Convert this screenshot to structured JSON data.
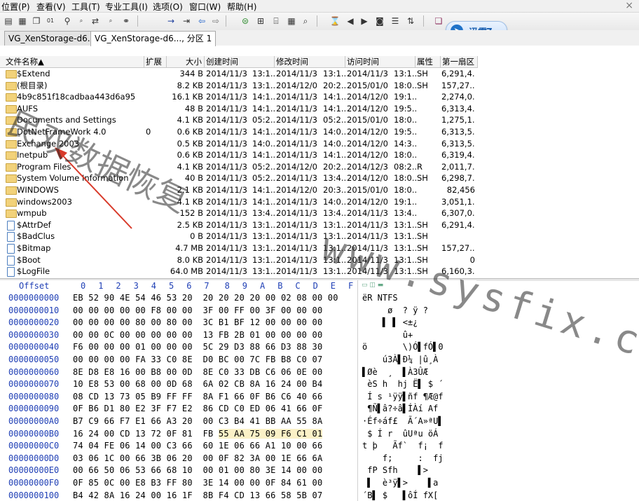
{
  "menu": [
    "位置(P)",
    "查看(V)",
    "工具(T)",
    "专业工具(I)",
    "选项(O)",
    "窗口(W)",
    "帮助(H)"
  ],
  "close_glyph": "×",
  "thunder_badge": "迅雷7",
  "tabs": [
    "VG_XenStorage-d6...",
    "VG_XenStorage-d6..., 分区 1"
  ],
  "columns": [
    "文件名称▲",
    "扩展",
    "大小",
    "创建时间",
    "修改时间",
    "访问时间",
    "属性",
    "第一扇区"
  ],
  "files": [
    {
      "name": "$Extend",
      "ext": "",
      "size": "344 B",
      "created": "2014/11/30",
      "ct": "13:1...",
      "modified": "2014/11/30",
      "mt": "13:1...",
      "accessed": "2014/11/30",
      "at": "13:1...",
      "attr": "SH",
      "sector": "6,291,4...",
      "icon": "folder"
    },
    {
      "name": "(根目录)",
      "ext": "",
      "size": "8.2 KB",
      "created": "2014/11/30",
      "ct": "13:1...",
      "modified": "2014/12/01",
      "mt": "20:2...",
      "accessed": "2015/01/03",
      "at": "18:0...",
      "attr": "SH",
      "sector": "157,27...",
      "icon": "folder"
    },
    {
      "name": "4b9c851f18cadbaa443d6a95",
      "ext": "",
      "size": "16.1 KB",
      "created": "2014/11/30",
      "ct": "14:1...",
      "modified": "2014/11/30",
      "mt": "14:1...",
      "accessed": "2014/12/01",
      "at": "19:1...",
      "attr": "",
      "sector": "2,274,0...",
      "icon": "folder"
    },
    {
      "name": "AUFS",
      "ext": "",
      "size": "48 B",
      "created": "2014/11/30",
      "ct": "14:1...",
      "modified": "2014/11/30",
      "mt": "14:1...",
      "accessed": "2014/12/01",
      "at": "19:5...",
      "attr": "",
      "sector": "6,313,4...",
      "icon": "folder"
    },
    {
      "name": "Documents and Settings",
      "ext": "",
      "size": "4.1 KB",
      "created": "2014/11/30",
      "ct": "05:2...",
      "modified": "2014/11/30",
      "mt": "05:2...",
      "accessed": "2015/01/03",
      "at": "18:0...",
      "attr": "",
      "sector": "1,275,1...",
      "icon": "folder"
    },
    {
      "name": "DotNetFrameWork 4.0",
      "ext": "0",
      "size": "0.6 KB",
      "created": "2014/11/30",
      "ct": "14:1...",
      "modified": "2014/11/30",
      "mt": "14:0...",
      "accessed": "2014/12/01",
      "at": "19:5...",
      "attr": "",
      "sector": "6,313,5...",
      "icon": "folder"
    },
    {
      "name": "Exchange 2003",
      "ext": "",
      "size": "0.5 KB",
      "created": "2014/11/30",
      "ct": "14:0...",
      "modified": "2014/11/30",
      "mt": "14:0...",
      "accessed": "2014/12/02",
      "at": "14:3...",
      "attr": "",
      "sector": "6,313,5...",
      "icon": "folder"
    },
    {
      "name": "Inetpub",
      "ext": "",
      "size": "0.6 KB",
      "created": "2014/11/30",
      "ct": "14:1...",
      "modified": "2014/11/30",
      "mt": "14:1...",
      "accessed": "2014/12/04",
      "at": "18:0...",
      "attr": "",
      "sector": "6,319,4...",
      "icon": "folder"
    },
    {
      "name": "Program Files",
      "ext": "",
      "size": "4.1 KB",
      "created": "2014/11/30",
      "ct": "05:2...",
      "modified": "2014/12/01",
      "mt": "20:2...",
      "accessed": "2014/12/31",
      "at": "08:2...",
      "attr": "R",
      "sector": "2,011,7...",
      "icon": "folder"
    },
    {
      "name": "System Volume Information",
      "ext": "",
      "size": "40 B",
      "created": "2014/11/30",
      "ct": "05:2...",
      "modified": "2014/11/30",
      "mt": "13:4...",
      "accessed": "2014/12/04",
      "at": "18:0...",
      "attr": "SH",
      "sector": "6,298,7...",
      "icon": "folder"
    },
    {
      "name": "WINDOWS",
      "ext": "",
      "size": "2.1 KB",
      "created": "2014/11/30",
      "ct": "14:1...",
      "modified": "2014/12/01",
      "mt": "20:3...",
      "accessed": "2015/01/03",
      "at": "18:0...",
      "attr": "",
      "sector": "82,456",
      "icon": "folder"
    },
    {
      "name": "windows2003",
      "ext": "",
      "size": "4.1 KB",
      "created": "2014/11/30",
      "ct": "14:1...",
      "modified": "2014/11/30",
      "mt": "14:0...",
      "accessed": "2014/12/01",
      "at": "19:1...",
      "attr": "",
      "sector": "3,051,1...",
      "icon": "folder"
    },
    {
      "name": "wmpub",
      "ext": "",
      "size": "152 B",
      "created": "2014/11/30",
      "ct": "13:4...",
      "modified": "2014/11/30",
      "mt": "13:4...",
      "accessed": "2014/11/30",
      "at": "13:4...",
      "attr": "",
      "sector": "6,307,0...",
      "icon": "folder"
    },
    {
      "name": "$AttrDef",
      "ext": "",
      "size": "2.5 KB",
      "created": "2014/11/30",
      "ct": "13:1...",
      "modified": "2014/11/30",
      "mt": "13:1...",
      "accessed": "2014/11/30",
      "at": "13:1...",
      "attr": "SH",
      "sector": "6,291,4...",
      "icon": "file"
    },
    {
      "name": "$BadClus",
      "ext": "",
      "size": "0 B",
      "created": "2014/11/30",
      "ct": "13:1...",
      "modified": "2014/11/30",
      "mt": "13:1...",
      "accessed": "2014/11/30",
      "at": "13:1...",
      "attr": "SH",
      "sector": "",
      "icon": "file"
    },
    {
      "name": "$Bitmap",
      "ext": "",
      "size": "4.7 MB",
      "created": "2014/11/30",
      "ct": "13:1...",
      "modified": "2014/11/30",
      "mt": "13:1...",
      "accessed": "2014/11/30",
      "at": "13:1...",
      "attr": "SH",
      "sector": "157,27...",
      "icon": "file"
    },
    {
      "name": "$Boot",
      "ext": "",
      "size": "8.0 KB",
      "created": "2014/11/30",
      "ct": "13:1...",
      "modified": "2014/11/30",
      "mt": "13:1...",
      "accessed": "2014/11/30",
      "at": "13:1...",
      "attr": "SH",
      "sector": "0",
      "icon": "file"
    },
    {
      "name": "$LogFile",
      "ext": "",
      "size": "64.0 MB",
      "created": "2014/11/30",
      "ct": "13:1...",
      "modified": "2014/11/30",
      "mt": "13:1...",
      "accessed": "2014/11/30",
      "at": "13:1...",
      "attr": "SH",
      "sector": "6,160,3...",
      "icon": "file"
    }
  ],
  "hex": {
    "offset_label": "Offset",
    "columns": [
      "0",
      "1",
      "2",
      "3",
      "4",
      "5",
      "6",
      "7",
      "8",
      "9",
      "A",
      "B",
      "C",
      "D",
      "E",
      "F"
    ],
    "rows": [
      {
        "off": "0000000000",
        "bytes": "EB 52 90 4E 54 46 53 20  20 20 20 20 00 02 08 00 00",
        "ascii": "ëR NTFS"
      },
      {
        "off": "0000000010",
        "bytes": "00 00 00 00 00 F8 00 00  3F 00 FF 00 3F 00 00 00",
        "ascii": "     ø  ? ÿ ?"
      },
      {
        "off": "0000000020",
        "bytes": "00 00 00 00 80 00 80 00  3C B1 BF 12 00 00 00 00",
        "ascii": "    ▌ ▌ <±¿"
      },
      {
        "off": "0000000030",
        "bytes": "00 00 0C 00 00 00 00 00  13 FB 2B 01 00 00 00 00",
        "ascii": "        û+"
      },
      {
        "off": "0000000040",
        "bytes": "F6 00 00 00 01 00 00 00  5C 29 D3 88 66 D3 88 30",
        "ascii": "ö       \\)Ó▌fÓ▌0"
      },
      {
        "off": "0000000050",
        "bytes": "00 00 00 00 FA 33 C0 8E  D0 BC 00 7C FB B8 C0 07",
        "ascii": "    ú3À▌Ð¼ |û¸À"
      },
      {
        "off": "0000000060",
        "bytes": "8E D8 E8 16 00 B8 00 0D  8E C0 33 DB C6 06 0E 00",
        "ascii": "▌Øè  ¸  ▌À3ÛÆ"
      },
      {
        "off": "0000000070",
        "bytes": "10 E8 53 00 68 00 0D 68  6A 02 CB 8A 16 24 00 B4",
        "ascii": " èS h  hj Ë▌ $ ´"
      },
      {
        "off": "0000000080",
        "bytes": "08 CD 13 73 05 B9 FF FF  8A F1 66 0F B6 C6 40 66",
        "ascii": " Í s ¹ÿÿ▌ñf ¶Æ@f"
      },
      {
        "off": "0000000090",
        "bytes": "0F B6 D1 80 E2 3F F7 E2  86 CD C0 ED 06 41 66 0F",
        "ascii": " ¶Ñ▌â?÷â▌ÍÀí Af"
      },
      {
        "off": "00000000A0",
        "bytes": "B7 C9 66 F7 E1 66 A3 20  00 C3 B4 41 BB AA 55 8A",
        "ascii": "·Éf÷áf£  Ã´A»ªU▌"
      },
      {
        "off": "00000000B0",
        "bytes": "16 24 00 CD 13 72 0F 81  FB 55 AA 75 09 F6 C1 01",
        "ascii": " $ Í r  ûUªu öÁ"
      },
      {
        "off": "00000000C0",
        "bytes": "74 04 FE 06 14 00 C3 66  60 1E 06 66 A1 10 00 66",
        "ascii": "t þ   Ãf`  f¡  f"
      },
      {
        "off": "00000000D0",
        "bytes": "03 06 1C 00 66 3B 06 20  00 0F 82 3A 00 1E 66 6A",
        "ascii": "    f;     :  fj"
      },
      {
        "off": "00000000E0",
        "bytes": "00 66 50 06 53 66 68 10  00 01 00 80 3E 14 00 00",
        "ascii": " fP Sfh    ▌>"
      },
      {
        "off": "00000000F0",
        "bytes": "0F 85 0C 00 E8 B3 FF 80  3E 14 00 00 0F 84 61 00",
        "ascii": " ▌  è³ÿ▌>    ▌a"
      },
      {
        "off": "0000000100",
        "bytes": "B4 42 8A 16 24 00 16 1F  8B F4 CD 13 66 58 5B 07",
        "ascii": "´B▌ $   ▌ôÍ fX["
      }
    ]
  },
  "watermark_cn": "民双数据恢复",
  "watermark_url": "www.sysfix.cn"
}
